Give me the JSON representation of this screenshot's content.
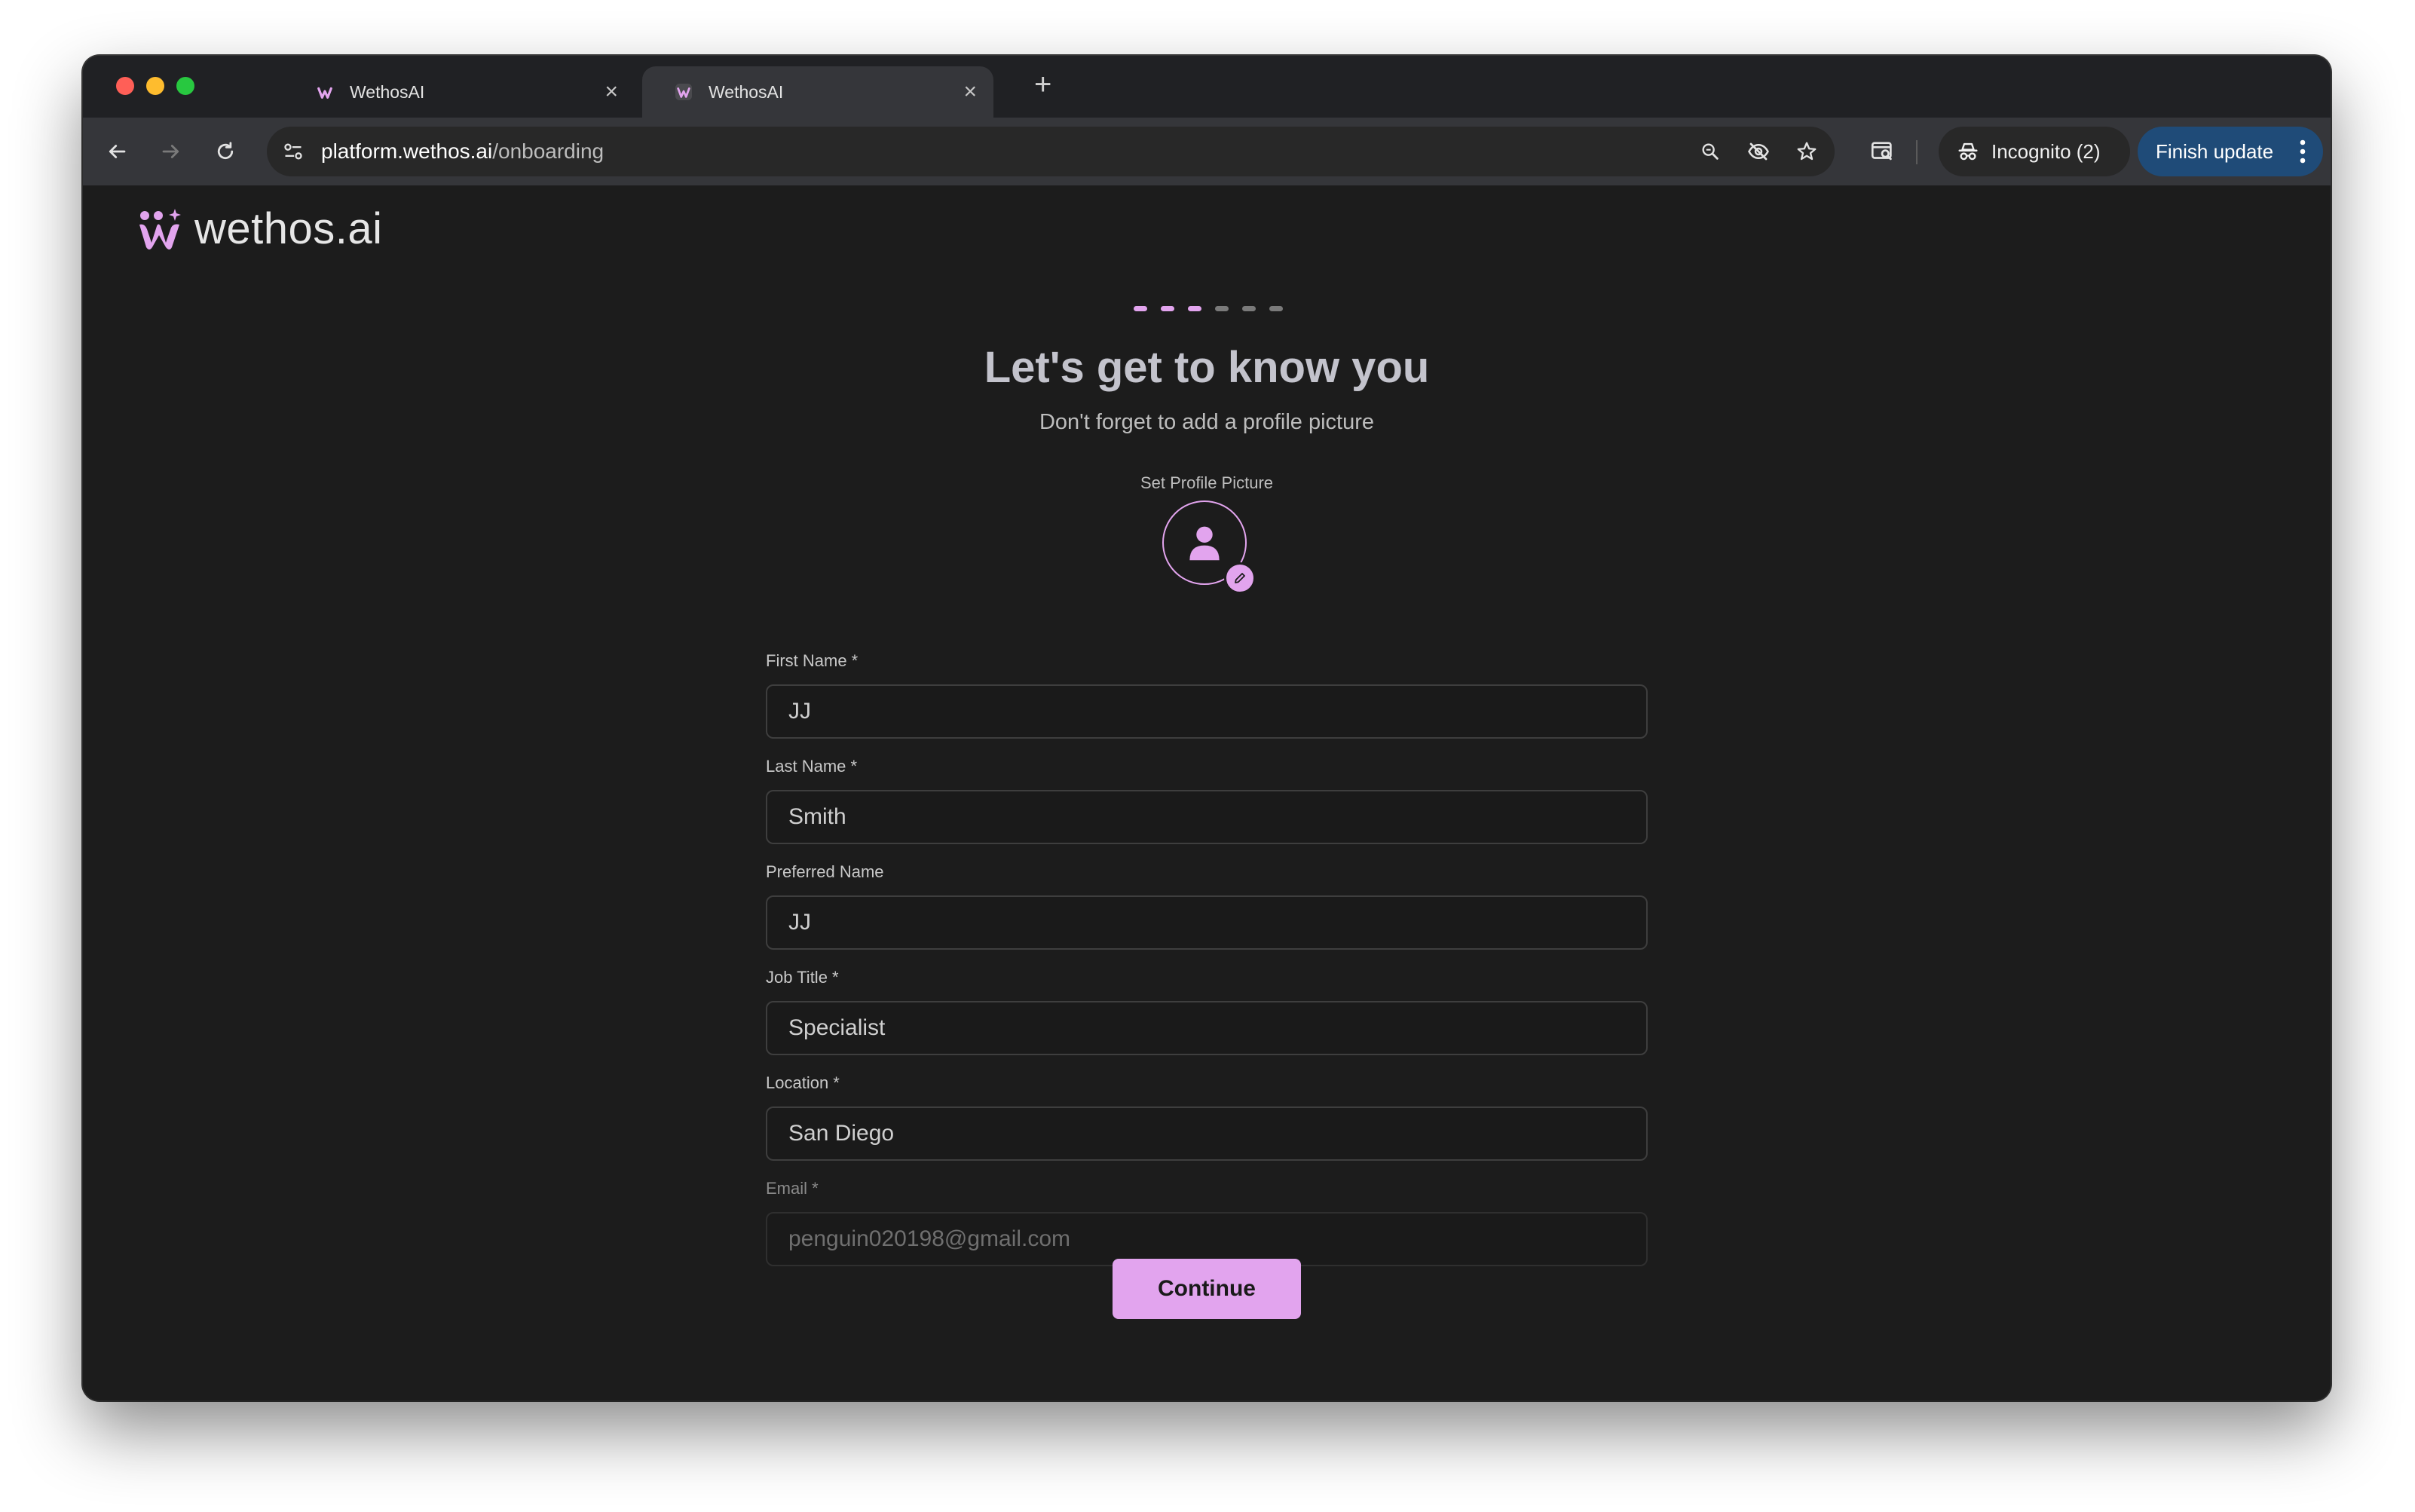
{
  "browser": {
    "tabs": [
      {
        "title": "WethosAI",
        "close": "×",
        "icon": "wethos-favicon-icon"
      },
      {
        "title": "WethosAI",
        "close": "×",
        "icon": "wethos-favicon-icon"
      }
    ],
    "new_tab": "+",
    "address": {
      "host": "platform.wethos.ai",
      "path": "/onboarding"
    },
    "incognito_label": "Incognito (2)",
    "finish_update_label": "Finish update"
  },
  "brand": {
    "logo_text": "wethos.ai",
    "accent": "#e2a4ee"
  },
  "onboarding": {
    "steps_total": 6,
    "steps_completed": 3,
    "title": "Let's get to know you",
    "subtitle": "Don't forget to add a profile picture",
    "profile_picture_label": "Set Profile Picture",
    "fields": {
      "first_name": {
        "label": "First Name *",
        "value": "JJ"
      },
      "last_name": {
        "label": "Last Name *",
        "value": "Smith"
      },
      "preferred_name": {
        "label": "Preferred Name",
        "value": "JJ"
      },
      "job_title": {
        "label": "Job Title *",
        "value": "Specialist"
      },
      "location": {
        "label": "Location *",
        "value": "San Diego"
      },
      "email": {
        "label": "Email *",
        "value": "penguin020198@gmail.com"
      }
    },
    "continue_label": "Continue"
  }
}
